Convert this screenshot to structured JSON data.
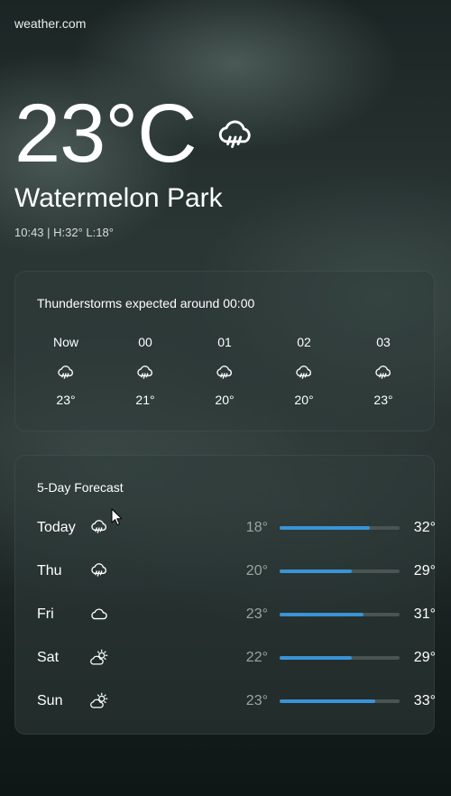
{
  "site": {
    "name": "weather.com"
  },
  "current": {
    "temperature": "23°C",
    "icon": "rain-cloud-icon",
    "location": "Watermelon Park",
    "meta": "10:43 | H:32° L:18°"
  },
  "hourly": {
    "title": "Thunderstorms expected around 00:00",
    "hours": [
      {
        "label": "Now",
        "icon": "rain-cloud-icon",
        "temp": "23°"
      },
      {
        "label": "00",
        "icon": "rain-cloud-icon",
        "temp": "21°"
      },
      {
        "label": "01",
        "icon": "rain-cloud-icon",
        "temp": "20°"
      },
      {
        "label": "02",
        "icon": "rain-cloud-icon",
        "temp": "20°"
      },
      {
        "label": "03",
        "icon": "rain-cloud-icon",
        "temp": "23°"
      }
    ]
  },
  "forecast": {
    "title": "5-Day Forecast",
    "days": [
      {
        "day": "Today",
        "icon": "rain-cloud-icon",
        "low": "18°",
        "high": "32°",
        "range_fill": 0.75
      },
      {
        "day": "Thu",
        "icon": "rain-cloud-icon",
        "low": "20°",
        "high": "29°",
        "range_fill": 0.6
      },
      {
        "day": "Fri",
        "icon": "cloud-icon",
        "low": "23°",
        "high": "31°",
        "range_fill": 0.7
      },
      {
        "day": "Sat",
        "icon": "partly-sunny-icon",
        "low": "22°",
        "high": "29°",
        "range_fill": 0.6
      },
      {
        "day": "Sun",
        "icon": "partly-sunny-icon",
        "low": "23°",
        "high": "33°",
        "range_fill": 0.8
      }
    ]
  },
  "colors": {
    "bar_fill": "#3a93d6",
    "bar_track": "#4a5553"
  }
}
